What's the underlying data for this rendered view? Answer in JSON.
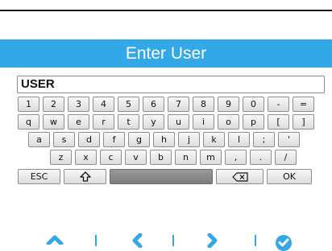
{
  "screen": {
    "title": "Enter User",
    "accent_color": "#33a8e6"
  },
  "input": {
    "value": "USER"
  },
  "keyboard": {
    "row1": [
      "1",
      "2",
      "3",
      "4",
      "5",
      "6",
      "7",
      "8",
      "9",
      "0",
      "-",
      "="
    ],
    "row2": [
      "q",
      "w",
      "e",
      "r",
      "t",
      "y",
      "u",
      "i",
      "o",
      "p",
      "[",
      "]"
    ],
    "row3": [
      "a",
      "s",
      "d",
      "f",
      "g",
      "h",
      "j",
      "k",
      "l",
      ";",
      "'"
    ],
    "row4": [
      "z",
      "x",
      "c",
      "v",
      "b",
      "n",
      "m",
      ",",
      ".",
      "/"
    ],
    "esc_label": "ESC",
    "shift_icon": "shift-arrow-icon",
    "space_icon": "blank",
    "backspace_icon": "backspace-icon",
    "ok_label": "OK"
  },
  "nav": {
    "icons": [
      "chevron-up-icon",
      "chevron-left-icon",
      "chevron-right-icon",
      "check-circle-icon"
    ]
  }
}
